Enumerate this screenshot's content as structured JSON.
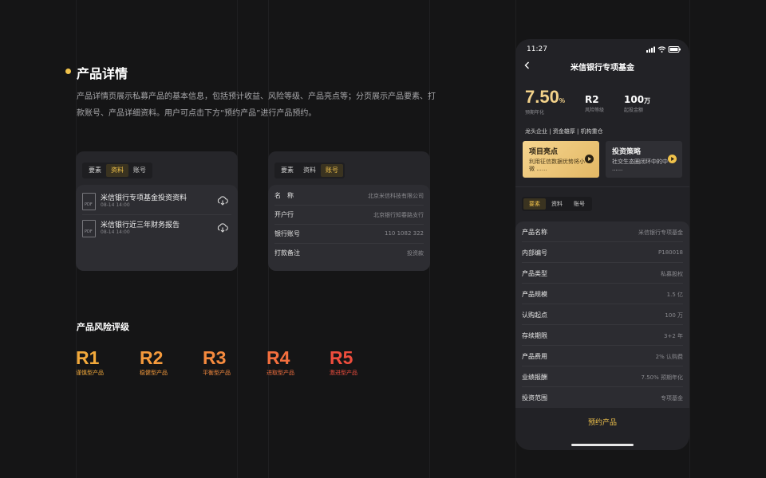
{
  "intro": {
    "title": "产品详情",
    "description": "产品详情页展示私募产品的基本信息，包括预计收益、风险等级、产品亮点等；分页展示产品要素、打款账号、产品详细资料。用户可点击下方“预约产品”进行产品预约。"
  },
  "card_docs": {
    "tabs": [
      "要素",
      "资料",
      "账号"
    ],
    "active_tab": "资料",
    "files": [
      {
        "icon": "pdf-icon",
        "name": "米信银行专项基金投资资料",
        "date": "08-14 14:00"
      },
      {
        "icon": "pdf-icon",
        "name": "米信银行近三年财务报告",
        "date": "08-14 14:00"
      }
    ]
  },
  "card_account": {
    "tabs": [
      "要素",
      "资料",
      "账号"
    ],
    "active_tab": "账号",
    "rows": [
      {
        "label": "名　称",
        "value": "北京米信科技有限公司"
      },
      {
        "label": "开户行",
        "value": "北京银行知春路支行"
      },
      {
        "label": "银行账号",
        "value": "110 1082 322"
      },
      {
        "label": "打款备注",
        "value": "投资款"
      }
    ]
  },
  "risk": {
    "title": "产品风险评级",
    "levels": [
      {
        "code": "R1",
        "name": "谨慎型产品",
        "color": "#f2a93b"
      },
      {
        "code": "R2",
        "name": "稳健型产品",
        "color": "#f59a3c"
      },
      {
        "code": "R3",
        "name": "平衡型产品",
        "color": "#f58a3e"
      },
      {
        "code": "R4",
        "name": "进取型产品",
        "color": "#f36f3e"
      },
      {
        "code": "R5",
        "name": "激进型产品",
        "color": "#ee4d3d"
      }
    ]
  },
  "phone": {
    "status_time": "11:27",
    "nav_title": "米信银行专项基金",
    "stats": [
      {
        "value": "7.50",
        "unit": "%",
        "label": "预期年化"
      },
      {
        "value": "R2",
        "unit": "",
        "label": "风险等级"
      },
      {
        "value": "100",
        "unit": "万",
        "label": "起投金额"
      }
    ],
    "tags": "龙头企业  |  资金雄厚  |  机构重仓",
    "features": [
      {
        "title": "项目亮点",
        "desc": "利用征信数据优势将小微 ......",
        "style": "gold"
      },
      {
        "title": "投资策略",
        "desc": "社交生态圈闭环中的中 ......",
        "style": "dark"
      }
    ],
    "tabs": [
      "要素",
      "资料",
      "账号"
    ],
    "active_tab": "要素",
    "details": [
      {
        "label": "产品名称",
        "value": "米信银行专项基金"
      },
      {
        "label": "内部编号",
        "value": "P180018"
      },
      {
        "label": "产品类型",
        "value": "私募股权"
      },
      {
        "label": "产品规模",
        "value": "1.5 亿"
      },
      {
        "label": "认购起点",
        "value": "100 万"
      },
      {
        "label": "存续期限",
        "value": "3+2 年"
      },
      {
        "label": "产品费用",
        "value": "2% 认购费"
      },
      {
        "label": "业绩报酬",
        "value": "7.50% 预期年化"
      },
      {
        "label": "投资范围",
        "value": "专项基金"
      }
    ],
    "reserve_label": "预约产品"
  },
  "colors": {
    "accent": "#f0c24b",
    "background": "#151516",
    "card": "#26262a"
  }
}
